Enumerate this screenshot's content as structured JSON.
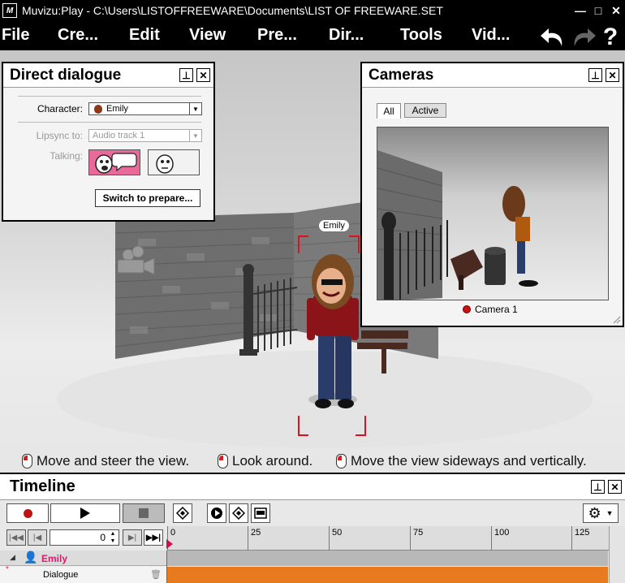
{
  "window": {
    "app_icon": "M",
    "title": "Muvizu:Play - C:\\Users\\LISTOFFREEWARE\\Documents\\LIST OF FREEWARE.SET",
    "minimize": "—",
    "maximize": "□",
    "close": "✕"
  },
  "menu": {
    "items": [
      "File",
      "Cre...",
      "Edit",
      "View",
      "Pre...",
      "Dir...",
      "Tools",
      "Vid..."
    ],
    "help": "?"
  },
  "direct_dialogue": {
    "title": "Direct dialogue",
    "character_label": "Character:",
    "character_value": "Emily",
    "lipsync_label": "Lipsync to:",
    "lipsync_value": "Audio track 1",
    "talking_label": "Talking:",
    "switch_button": "Switch to prepare..."
  },
  "cameras": {
    "title": "Cameras",
    "tabs": [
      "All",
      "Active"
    ],
    "active_tab": "All",
    "camera_label": "Camera 1",
    "camera_color": "#d01010"
  },
  "scene": {
    "character_tag": "Emily"
  },
  "hints": [
    "Move and steer the view.",
    "Look around.",
    "Move the view sideways and vertically."
  ],
  "timeline": {
    "title": "Timeline",
    "frame_value": "0",
    "ruler_ticks": [
      "0",
      "25",
      "50",
      "75",
      "100",
      "125"
    ],
    "track_character": "Emily",
    "track_dialogue": "Dialogue",
    "character_color": "#e0186c",
    "dialogue_bar_color": "#e87a20"
  }
}
